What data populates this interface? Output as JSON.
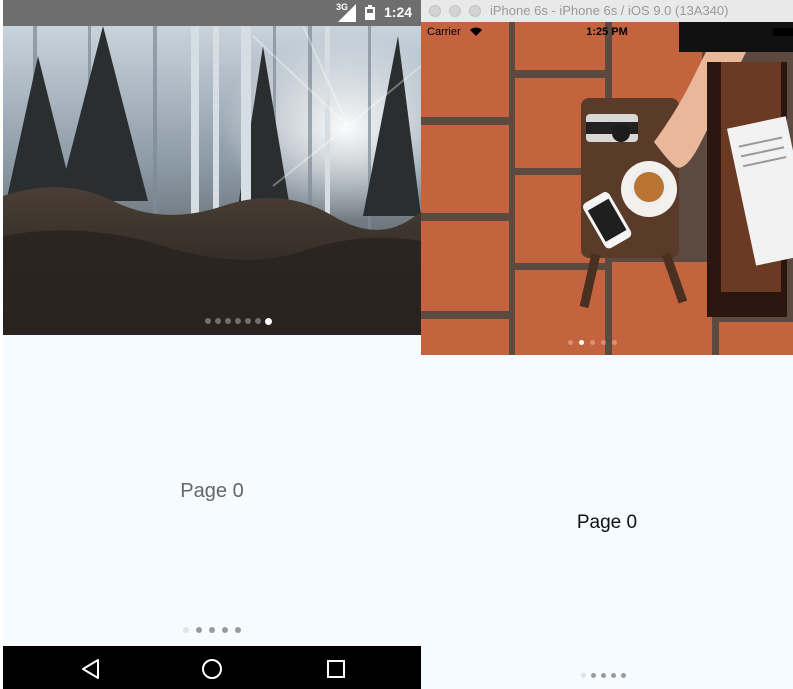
{
  "android": {
    "status_bar": {
      "network": "3G",
      "time": "1:24"
    },
    "hero": {
      "image": "forest-photo",
      "dot_count": 7,
      "active_index": 6
    },
    "page": {
      "label": "Page 0",
      "dot_count": 5,
      "active_index": 0
    },
    "nav_bar": {
      "icons": [
        "back-icon",
        "home-icon",
        "recents-icon"
      ]
    }
  },
  "ios": {
    "simulator_title": "iPhone 6s - iPhone 6s / iOS 9.0 (13A340)",
    "status_bar": {
      "carrier": "Carrier",
      "time": "1:25 PM"
    },
    "hero": {
      "image": "tea-table-photo",
      "dot_count": 5,
      "active_index": 1
    },
    "page": {
      "label": "Page 0",
      "dot_count": 5,
      "active_index": 0
    }
  },
  "colors": {
    "page_background": "#f5fbff",
    "android_status_bar": "#6e6e6e",
    "android_nav_bar": "#000000",
    "simulator_titlebar": "#e9e9e9",
    "tile": "#c4643e"
  }
}
